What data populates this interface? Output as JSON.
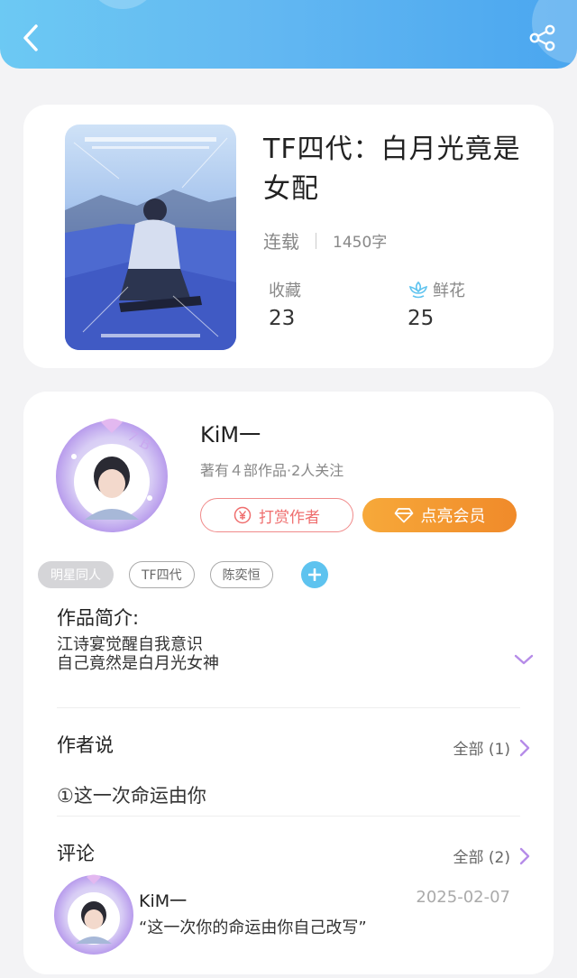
{
  "header": {
    "back_icon": "chevron-left-icon",
    "share_icon": "share-icon"
  },
  "book": {
    "title": "TF四代：白月光竟是女配",
    "status": "连载",
    "word_count": "1450字",
    "favorites_label": "收藏",
    "favorites_value": "23",
    "flowers_label": "鲜花",
    "flowers_value": "25",
    "flower_icon": "flower-icon",
    "cover_icon": "book-cover-image"
  },
  "author": {
    "name": "KiM一",
    "meta": "著有４部作品·2人关注",
    "tip_button": "打赏作者",
    "vip_button": "点亮会员",
    "avatar": "author-avatar"
  },
  "tags": [
    "明星同人",
    "TF四代",
    "陈奕恒"
  ],
  "intro": {
    "title": "作品简介:",
    "line1": "江诗宴觉醒自我意识",
    "line2": "自己竟然是白月光女神"
  },
  "author_says": {
    "title": "作者说",
    "more": "全部 (1)",
    "text": "①这一次命运由你"
  },
  "comments": {
    "title": "评论",
    "more": "全部 (2)",
    "items": [
      {
        "name": "KiM一",
        "date": "2025-02-07",
        "text": "“这一次你的命运由你自己改写”"
      }
    ]
  },
  "colors": {
    "header_start": "#6cc9f3",
    "header_end": "#4aa6ef",
    "tip_red": "#ef6e6e",
    "vip_orange": "#f39432",
    "accent_purple": "#b68ce8",
    "tag_add_blue": "#5ec3ef"
  }
}
